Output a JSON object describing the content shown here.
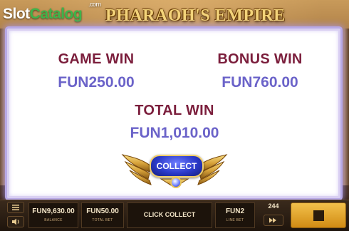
{
  "watermark": {
    "text_white": "Slot",
    "text_green": "Catalog",
    "suffix": ".com"
  },
  "game": {
    "title": "PHARAOH'S EMPIRE"
  },
  "win_panel": {
    "game_win_label": "GAME WIN",
    "game_win_value": "FUN250.00",
    "bonus_win_label": "BONUS WIN",
    "bonus_win_value": "FUN760.00",
    "total_win_label": "TOTAL WIN",
    "total_win_value": "FUN1,010.00",
    "collect_label": "COLLECT"
  },
  "bottom_bar": {
    "balance_value": "FUN9,630.00",
    "balance_label": "BALANCE",
    "total_bet_value": "FUN50.00",
    "total_bet_label": "TOTAL BET",
    "message": "CLICK COLLECT",
    "line_bet_value": "FUN2",
    "line_bet_label": "LINE BET",
    "lines_value": "244"
  },
  "icons": {
    "menu": "menu-icon",
    "sound": "speaker-icon",
    "fast": "fast-forward-icon",
    "spin": "stop-icon"
  },
  "colors": {
    "label_maroon": "#7b1e3c",
    "value_purple": "#6b63c9",
    "panel_glow": "#b8a9e6",
    "spin_gold": "#e6a92c"
  }
}
